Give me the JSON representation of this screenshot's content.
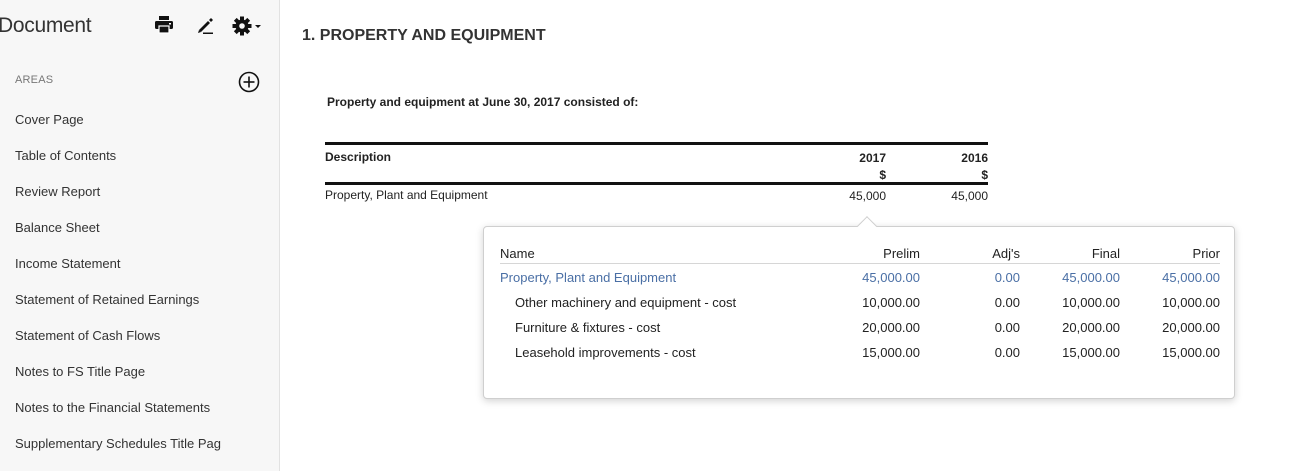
{
  "sidebar": {
    "title": "Document",
    "areas_label": "AREAS",
    "items": [
      {
        "label": "Cover Page"
      },
      {
        "label": "Table of Contents"
      },
      {
        "label": "Review Report"
      },
      {
        "label": "Balance Sheet"
      },
      {
        "label": "Income Statement"
      },
      {
        "label": "Statement of Retained Earnings"
      },
      {
        "label": "Statement of Cash Flows"
      },
      {
        "label": "Notes to FS Title Page"
      },
      {
        "label": "Notes to the Financial Statements"
      },
      {
        "label": "Supplementary Schedules Title Pag"
      }
    ]
  },
  "note": {
    "title": "1. PROPERTY AND EQUIPMENT",
    "intro": "Property and equipment at June 30, 2017 consisted of:",
    "table": {
      "headers": {
        "description": "Description",
        "year1": "2017",
        "year1_unit": "$",
        "year2": "2016",
        "year2_unit": "$"
      },
      "rows": [
        {
          "description": "Property, Plant and Equipment",
          "year1": "45,000",
          "year2": "45,000"
        }
      ]
    }
  },
  "popover": {
    "headers": {
      "name": "Name",
      "prelim": "Prelim",
      "adj": "Adj's",
      "final": "Final",
      "prior": "Prior"
    },
    "rows": [
      {
        "name": "Property, Plant and Equipment",
        "prelim": "45,000.00",
        "adj": "0.00",
        "final": "45,000.00",
        "prior": "45,000.00"
      },
      {
        "name": "Other machinery and equipment - cost",
        "prelim": "10,000.00",
        "adj": "0.00",
        "final": "10,000.00",
        "prior": "10,000.00"
      },
      {
        "name": "Furniture & fixtures - cost",
        "prelim": "20,000.00",
        "adj": "0.00",
        "final": "20,000.00",
        "prior": "20,000.00"
      },
      {
        "name": "Leasehold improvements - cost",
        "prelim": "15,000.00",
        "adj": "0.00",
        "final": "15,000.00",
        "prior": "15,000.00"
      }
    ]
  },
  "colors": {
    "link": "#4a6fa5",
    "sidebar_bg": "#f7f7f7"
  },
  "icons": [
    "print-icon",
    "edit-pen-icon",
    "gear-icon",
    "caret-down-icon",
    "add-circle-icon"
  ]
}
